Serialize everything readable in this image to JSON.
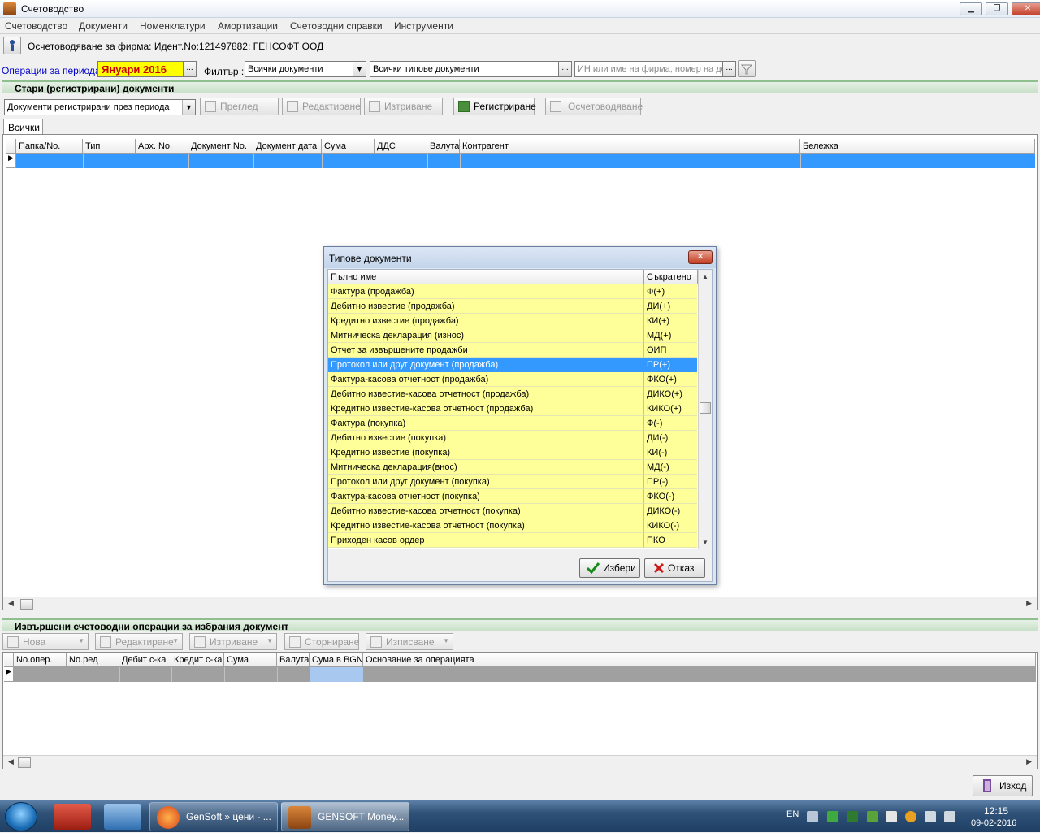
{
  "window": {
    "title": "Счетоводство",
    "controls": {
      "minimize": "▁",
      "maximize": "❐",
      "close": "✕"
    }
  },
  "menu": [
    "Счетоводство",
    "Документи",
    "Номенклатури",
    "Амортизации",
    "Счетоводни справки",
    "Инструменти"
  ],
  "firm": {
    "text": "Осчетоводяване за фирма:  Идент.No:121497882; ГЕНСОФТ ООД"
  },
  "period": {
    "label": "Операции за периода:",
    "value": "Януари 2016",
    "dots": "..."
  },
  "filter": {
    "label": "Филтър :",
    "documents_value": "Всички документи",
    "types_value": "Всички типове документи",
    "search_placeholder": "ИН или име на фирма; номер на док"
  },
  "old_docs": {
    "header": "Стари (регистрирани) документи",
    "period_combo": "Документи регистрирани през периода",
    "buttons": {
      "view": "Преглед",
      "edit": "Редактиране",
      "delete": "Изтриване",
      "register": "Регистриране",
      "post": "Осчетоводяване"
    },
    "tab": "Всички",
    "columns": [
      "Папка/No.",
      "Тип",
      "Арх. No.",
      "Документ No.",
      "Документ дата",
      "Сума",
      "ДДС",
      "Валута",
      "Контрагент",
      "Бележка"
    ]
  },
  "ops": {
    "header": "Извършени счетоводни операции за избрания документ",
    "buttons": {
      "new": "Нова",
      "edit": "Редактиране",
      "delete": "Изтриване",
      "reverse": "Сторниране",
      "print": "Изписване"
    },
    "columns": [
      "No.опер.",
      "No.ред",
      "Дебит с-ка",
      "Кредит с-ка",
      "Сума",
      "Валута",
      "Сума в BGN",
      "Основание за операцията"
    ]
  },
  "dialog": {
    "title": "Типове документи",
    "col_full": "Пълно име",
    "col_short": "Съкратено",
    "rows": [
      {
        "full": "Фактура (продажба)",
        "short": "Ф(+)"
      },
      {
        "full": "Дебитно известие (продажба)",
        "short": "ДИ(+)"
      },
      {
        "full": "Кредитно известие (продажба)",
        "short": "КИ(+)"
      },
      {
        "full": "Митническа декларация (износ)",
        "short": "МД(+)"
      },
      {
        "full": "Отчет за извършените продажби",
        "short": "ОИП"
      },
      {
        "full": "Протокол или друг документ (продажба)",
        "short": "ПР(+)"
      },
      {
        "full": "Фактура-касова отчетност (продажба)",
        "short": "ФКО(+)"
      },
      {
        "full": "Дебитно известие-касова отчетност (продажба)",
        "short": "ДИКО(+)"
      },
      {
        "full": "Кредитно известие-касова отчетност (продажба)",
        "short": "КИКО(+)"
      },
      {
        "full": "Фактура (покупка)",
        "short": "Ф(-)"
      },
      {
        "full": "Дебитно известие (покупка)",
        "short": "ДИ(-)"
      },
      {
        "full": "Кредитно известие (покупка)",
        "short": "КИ(-)"
      },
      {
        "full": "Митническа декларация(внос)",
        "short": "МД(-)"
      },
      {
        "full": "Протокол или друг документ (покупка)",
        "short": "ПР(-)"
      },
      {
        "full": "Фактура-касова отчетност (покупка)",
        "short": "ФКО(-)"
      },
      {
        "full": "Дебитно известие-касова отчетност (покупка)",
        "short": "ДИКО(-)"
      },
      {
        "full": "Кредитно известие-касова отчетност (покупка)",
        "short": "КИКО(-)"
      },
      {
        "full": "Приходен касов ордер",
        "short": "ПКО"
      }
    ],
    "selected_index": 5,
    "ok": "Избери",
    "cancel": "Отказ"
  },
  "exit": "Изход",
  "taskbar": {
    "tasks": [
      "GenSoft » цени - ...",
      "GENSOFT Money..."
    ],
    "lang": "EN",
    "time": "12:15",
    "date": "09-02-2016"
  },
  "colors": {
    "accent": "#3399ff",
    "period_bg": "#ffff00",
    "period_fg": "#cc0000",
    "dialog_row": "#ffff99"
  }
}
